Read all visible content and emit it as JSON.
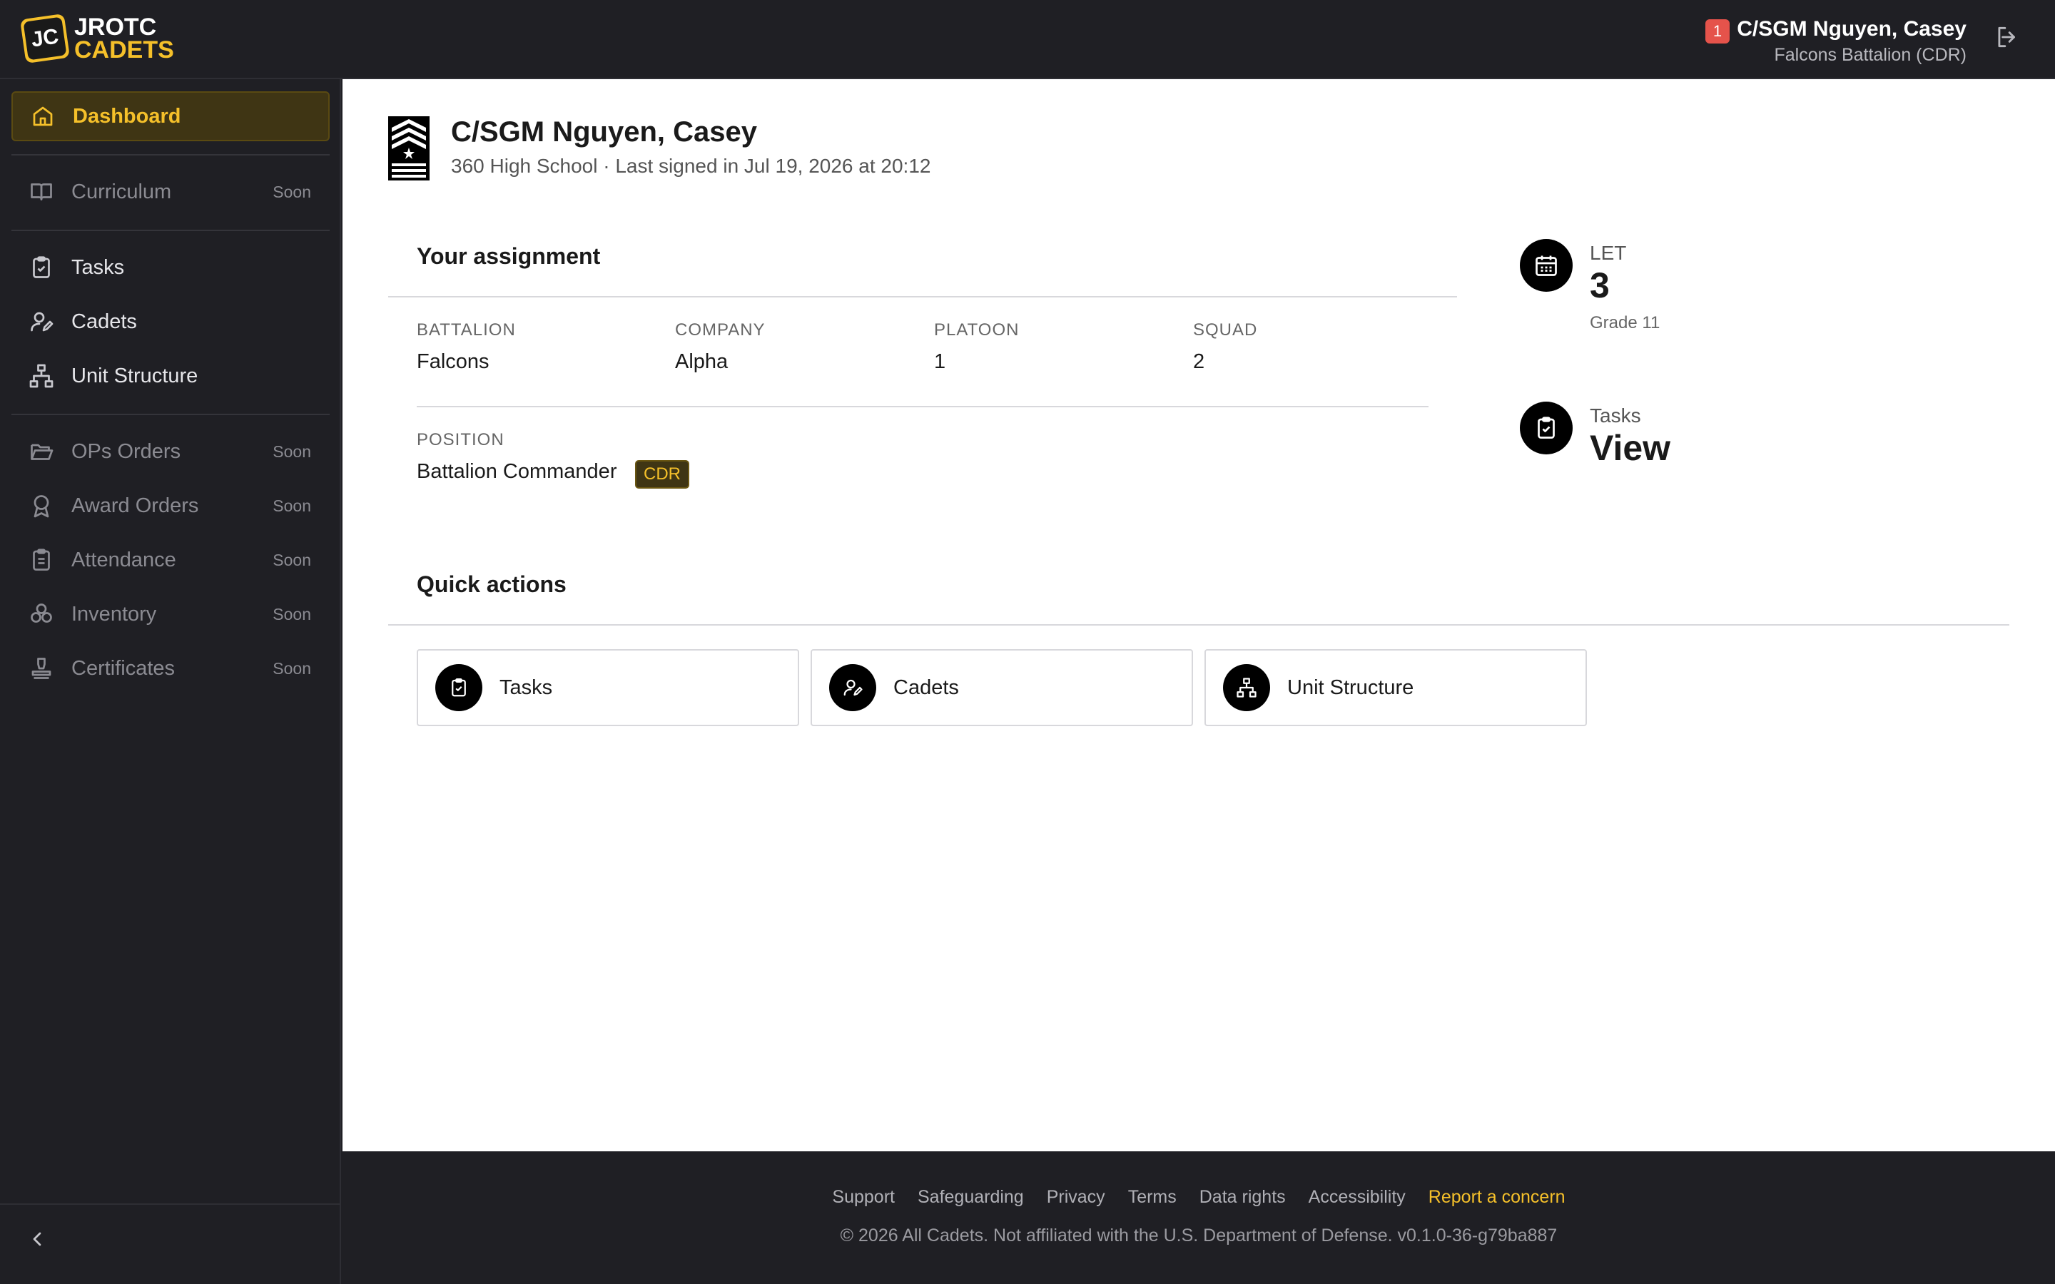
{
  "app": {
    "logo_text_top": "JROTC",
    "logo_text_bottom": "CADETS",
    "logo_badge": "JC"
  },
  "header": {
    "notification_count": "1",
    "user_name": "C/SGM Nguyen, Casey",
    "user_unit": "Falcons Battalion (CDR)"
  },
  "sidebar": {
    "items": [
      {
        "label": "Dashboard",
        "icon": "home-icon",
        "state": "active"
      },
      {
        "label": "Curriculum",
        "icon": "book-icon",
        "state": "disabled",
        "badge": "Soon"
      },
      {
        "label": "Tasks",
        "icon": "clipboard-check-icon",
        "state": "enabled"
      },
      {
        "label": "Cadets",
        "icon": "user-edit-icon",
        "state": "enabled"
      },
      {
        "label": "Unit Structure",
        "icon": "hierarchy-icon",
        "state": "enabled"
      },
      {
        "label": "OPs Orders",
        "icon": "folder-open-icon",
        "state": "disabled",
        "badge": "Soon"
      },
      {
        "label": "Award Orders",
        "icon": "award-icon",
        "state": "disabled",
        "badge": "Soon"
      },
      {
        "label": "Attendance",
        "icon": "clipboard-list-icon",
        "state": "disabled",
        "badge": "Soon"
      },
      {
        "label": "Inventory",
        "icon": "boxes-icon",
        "state": "disabled",
        "badge": "Soon"
      },
      {
        "label": "Certificates",
        "icon": "stamp-icon",
        "state": "disabled",
        "badge": "Soon"
      }
    ]
  },
  "profile": {
    "name": "C/SGM Nguyen, Casey",
    "subtitle": "360 High School · Last signed in Jul 19, 2026 at 20:12"
  },
  "assignment": {
    "title": "Your assignment",
    "battalion_label": "BATTALION",
    "battalion": "Falcons",
    "company_label": "COMPANY",
    "company": "Alpha",
    "platoon_label": "PLATOON",
    "platoon": "1",
    "squad_label": "SQUAD",
    "squad": "2",
    "position_label": "POSITION",
    "position": "Battalion Commander",
    "position_badge": "CDR"
  },
  "stats": {
    "let_label": "LET",
    "let_value": "3",
    "let_sub": "Grade 11",
    "tasks_label": "Tasks",
    "tasks_value": "View"
  },
  "quick_actions": {
    "title": "Quick actions",
    "items": [
      {
        "label": "Tasks",
        "icon": "clipboard-check-icon"
      },
      {
        "label": "Cadets",
        "icon": "user-edit-icon"
      },
      {
        "label": "Unit Structure",
        "icon": "hierarchy-icon"
      }
    ]
  },
  "footer": {
    "links": [
      "Support",
      "Safeguarding",
      "Privacy",
      "Terms",
      "Data rights",
      "Accessibility"
    ],
    "report": "Report a concern",
    "copyright": "© 2026 All Cadets. Not affiliated with the U.S. Department of Defense. v0.1.0-36-g79ba887"
  },
  "colors": {
    "accent": "#f5c02a",
    "dark_bg": "#1f1f24",
    "badge_red": "#e5534b"
  }
}
